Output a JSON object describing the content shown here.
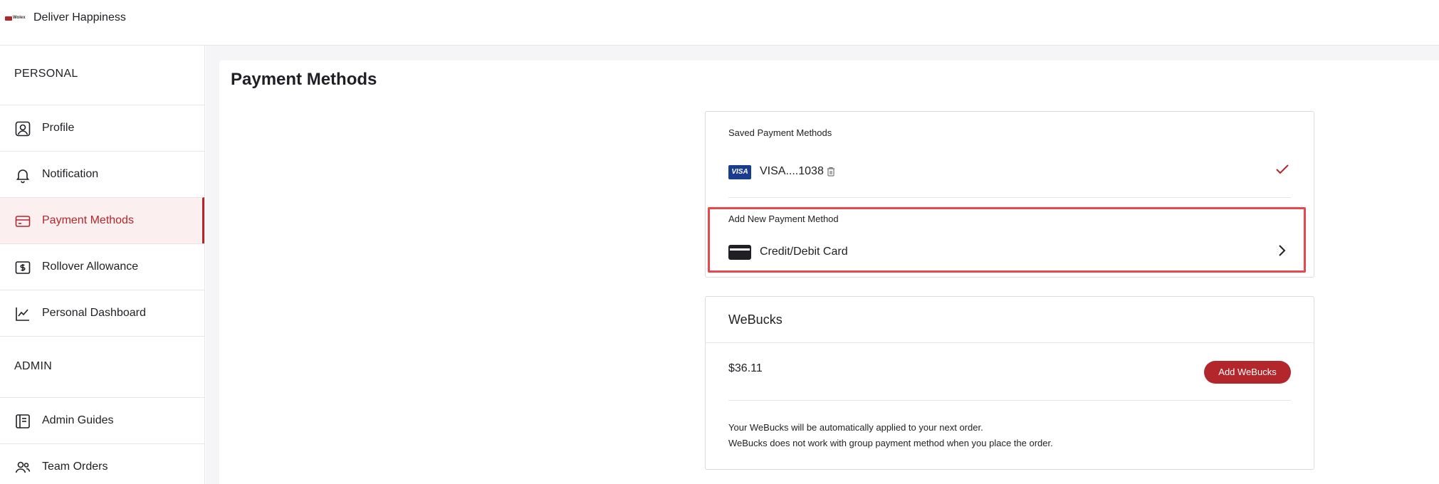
{
  "header": {
    "logo_text": "Wolex",
    "brand": "Deliver Happiness"
  },
  "sidebar": {
    "personal_title": "PERSONAL",
    "admin_title": "ADMIN",
    "personal_items": [
      {
        "label": "Profile",
        "icon": "user-icon"
      },
      {
        "label": "Notification",
        "icon": "bell-icon"
      },
      {
        "label": "Payment Methods",
        "icon": "credit-card-icon",
        "active": true
      },
      {
        "label": "Rollover Allowance",
        "icon": "money-icon"
      },
      {
        "label": "Personal Dashboard",
        "icon": "line-chart-icon"
      }
    ],
    "admin_items": [
      {
        "label": "Admin Guides",
        "icon": "book-icon"
      },
      {
        "label": "Team Orders",
        "icon": "team-icon"
      }
    ]
  },
  "main": {
    "page_title": "Payment Methods",
    "saved": {
      "heading": "Saved Payment Methods",
      "card_brand": "VISA",
      "card_label": "VISA....1038"
    },
    "add_new": {
      "heading": "Add New Payment Method",
      "option_label": "Credit/Debit Card"
    },
    "webucks": {
      "title": "WeBucks",
      "balance": "$36.11",
      "add_button": "Add WeBucks",
      "note_1": "Your WeBucks will be automatically applied to your next order.",
      "note_2": "WeBucks does not work with group payment method when you place the order."
    }
  },
  "colors": {
    "accent": "#b3262b",
    "highlight_border": "#e5484d",
    "visa_blue": "#1a3c8f"
  }
}
